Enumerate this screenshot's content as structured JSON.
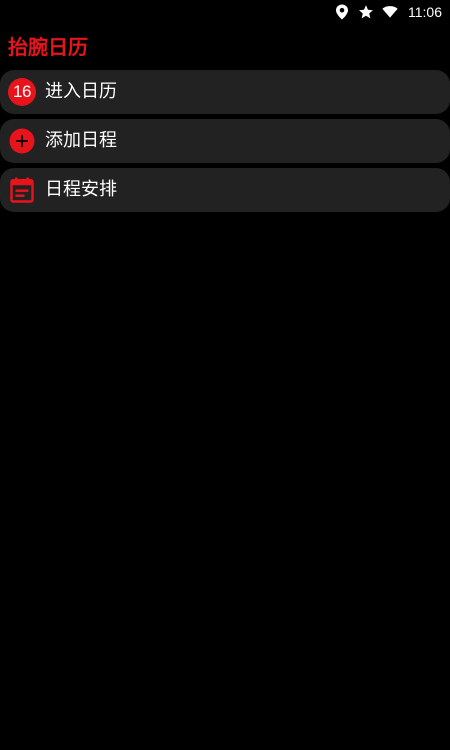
{
  "colors": {
    "background": "#000000",
    "accent": "#e8141c",
    "item_background": "#222222",
    "text": "#ffffff"
  },
  "status_bar": {
    "icons": [
      "location-icon",
      "star-icon",
      "wifi-icon"
    ],
    "time": "11:06"
  },
  "app": {
    "title": "抬腕日历"
  },
  "menu": {
    "items": [
      {
        "label": "进入日历",
        "icon": "calendar-day-badge-icon",
        "badge": "16"
      },
      {
        "label": "添加日程",
        "icon": "add-circle-icon"
      },
      {
        "label": "日程安排",
        "icon": "calendar-event-icon"
      }
    ]
  }
}
